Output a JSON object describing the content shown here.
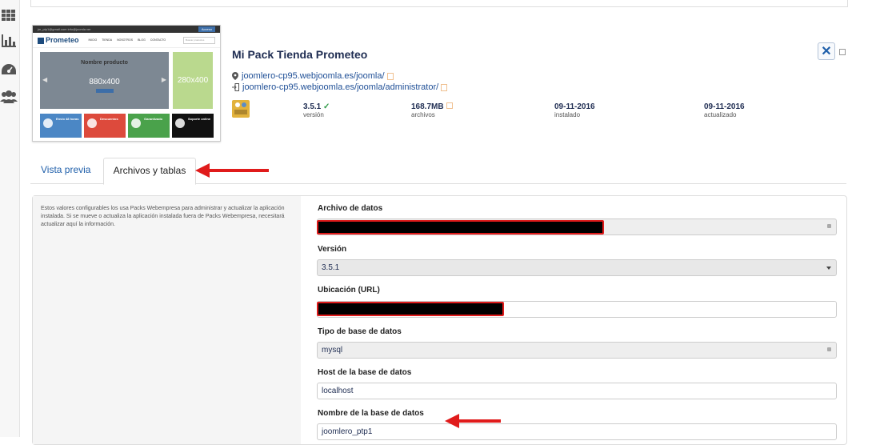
{
  "sidebar": {
    "icons": [
      "grid-icon",
      "bar-chart-icon",
      "dashboard-icon",
      "users-icon"
    ]
  },
  "thumbnail": {
    "topbar_text": "jm_ptp1@gmail.com   info@joomla   ver",
    "topbar_button": "Acceso",
    "logo": "Prometeo",
    "nav": [
      "INICIO",
      "TIENDA",
      "NOSOTROS",
      "BLOG",
      "CONTACTO"
    ],
    "search_placeholder": "Buscar productos",
    "hero_title": "Nombre producto",
    "hero_dims": "880x400",
    "side_dims": "280x400",
    "tiles": [
      {
        "title": "Envío 48 horas",
        "color": "#4b87c5"
      },
      {
        "title": "Descuentos",
        "color": "#dd4a3c"
      },
      {
        "title": "Garantizado",
        "color": "#4aa24b"
      },
      {
        "title": "Soporte online",
        "color": "#111111"
      }
    ]
  },
  "app": {
    "title": "Mi Pack Tienda Prometeo",
    "close_label": "✕",
    "site_url": "joomlero-cp95.webjoomla.es/joomla/",
    "admin_url": "joomlero-cp95.webjoomla.es/joomla/administrator/",
    "meta": [
      {
        "value": "3.5.1",
        "label": "versión",
        "check": "✓"
      },
      {
        "value": "168.7MB",
        "label": "archivos"
      },
      {
        "value": "09-11-2016",
        "label": "instalado"
      },
      {
        "value": "09-11-2016",
        "label": "actualizado"
      }
    ]
  },
  "tabs": [
    {
      "label": "Vista previa"
    },
    {
      "label": "Archivos y tablas"
    }
  ],
  "form": {
    "help_text": "Estos valores configurables los usa Packs Webempresa para administrar y actualizar la aplicación instalada. Si se mueve o actualiza la aplicación instalada fuera de Packs Webempresa, necesitará actualizar aquí la información.",
    "fields": [
      {
        "label": "Archivo de datos",
        "value": ""
      },
      {
        "label": "Versión",
        "value": "3.5.1"
      },
      {
        "label": "Ubicación (URL)",
        "value": ""
      },
      {
        "label": "Tipo de base de datos",
        "value": "mysql"
      },
      {
        "label": "Host de la base de datos",
        "value": "localhost"
      },
      {
        "label": "Nombre de la base de datos",
        "value": "joomlero_ptp1"
      }
    ]
  },
  "colors": {
    "annotation_arrow": "#e01b1b",
    "link": "#1f4f96",
    "title": "#1f2d52"
  }
}
